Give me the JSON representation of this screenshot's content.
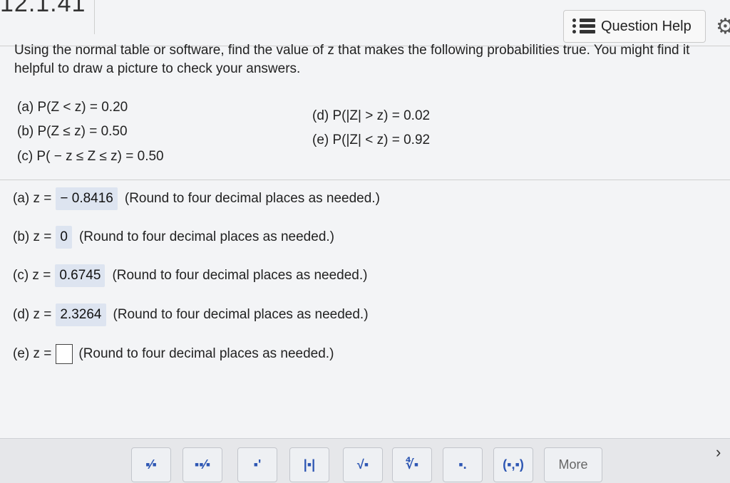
{
  "header": {
    "problem_number": "12.1.41",
    "help_label": "Question Help"
  },
  "question": {
    "prompt": "Using the normal table or software, find the value of z that makes the following probabilities true. You might find it helpful to draw a picture to check your answers.",
    "parts_left": [
      "(a) P(Z < z) = 0.20",
      "(b) P(Z ≤ z) = 0.50",
      "(c) P( − z ≤ Z ≤ z) = 0.50"
    ],
    "parts_right": [
      "(d) P(|Z| > z) = 0.02",
      "(e) P(|Z| < z) = 0.92"
    ]
  },
  "answers": [
    {
      "prefix": "(a) z =",
      "value": "− 0.8416",
      "hint": "(Round to four decimal places as needed.)"
    },
    {
      "prefix": "(b) z =",
      "value": "0",
      "hint": "(Round to four decimal places as needed.)"
    },
    {
      "prefix": "(c) z =",
      "value": "0.6745",
      "hint": "(Round to four decimal places as needed.)"
    },
    {
      "prefix": "(d) z =",
      "value": "2.3264",
      "hint": "(Round to four decimal places as needed.)"
    },
    {
      "prefix": "(e) z =",
      "value": "",
      "hint": "(Round to four decimal places as needed.)"
    }
  ],
  "toolbar": {
    "buttons": [
      {
        "icon": "fraction-icon",
        "glyph": "▪⁄▪"
      },
      {
        "icon": "mixed-number-icon",
        "glyph": "▪▪⁄▪"
      },
      {
        "icon": "exponent-icon",
        "glyph": "▪'"
      },
      {
        "icon": "absolute-value-icon",
        "glyph": "|▪|"
      },
      {
        "icon": "square-root-icon",
        "glyph": "√▪"
      },
      {
        "icon": "nth-root-icon",
        "glyph": "∜▪"
      },
      {
        "icon": "decimal-icon",
        "glyph": "▪."
      },
      {
        "icon": "ordered-pair-icon",
        "glyph": "(▪,▪)"
      }
    ],
    "more_label": "More"
  }
}
